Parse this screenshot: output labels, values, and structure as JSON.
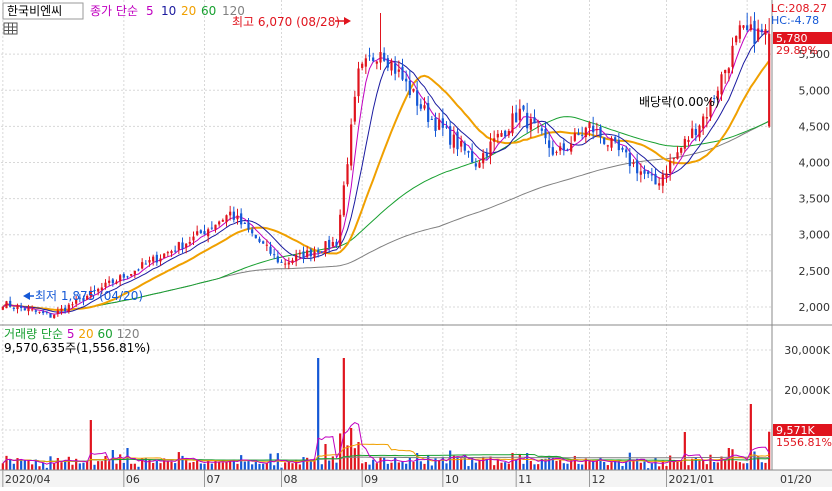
{
  "header": {
    "stock_name": "한국비엔씨",
    "price_label": "종가",
    "ma_label": "단순",
    "ma_periods": [
      "5",
      "10",
      "20",
      "60",
      "120"
    ],
    "lc_text": "LC:208.27",
    "hc_text": "HC:-4.78"
  },
  "volume_header": {
    "title": "거래량",
    "ma_label": "단순",
    "ma_periods": [
      "5",
      "20",
      "60",
      "120"
    ],
    "current_value_text": "9,570,635주(1,556.81%)"
  },
  "annotations": {
    "high_text": "최고 6,070 (08/28)",
    "low_text": "최저 1,875 (04/20)",
    "dividend_text": "배당락(0.00%)"
  },
  "price_badge": {
    "value": "5,780",
    "pct": "29.89%"
  },
  "volume_badge": {
    "value": "9,571K",
    "pct": "1556.81%"
  },
  "colors": {
    "up": "#e0141e",
    "down": "#1458d6",
    "ma5": "#c000c0",
    "ma10": "#1a1aa0",
    "ma20": "#f0a000",
    "ma60": "#18a030",
    "ma120": "#808080",
    "grid": "#d8d8d8"
  },
  "chart_data": [
    {
      "type": "candlestick",
      "title": "한국비엔씨 종가",
      "y_ticks": [
        2000,
        2500,
        3000,
        3500,
        4000,
        4500,
        5000,
        5500
      ],
      "y_tick_labels": [
        "2,000",
        "2,500",
        "3,000",
        "3,500",
        "4,000",
        "4,500",
        "5,000",
        "5,500"
      ],
      "ylim": [
        1750,
        6250
      ],
      "x_tick_labels": [
        "2020/04",
        "06",
        "07",
        "08",
        "09",
        "10",
        "11",
        "12",
        "2021/01",
        "01/20"
      ],
      "x_tick_index": [
        0,
        33,
        55,
        76,
        98,
        120,
        140,
        160,
        181,
        203
      ],
      "high": {
        "date": "08/28",
        "value": 6070
      },
      "low": {
        "date": "04/20",
        "value": 1875
      },
      "last_close": 5780,
      "last_change_pct": 29.89,
      "key_closes": [
        {
          "date": "2020/04/20",
          "value": 1875
        },
        {
          "date": "2020/06/15",
          "value": 2950
        },
        {
          "date": "2020/06/29",
          "value": 3300
        },
        {
          "date": "2020/07/20",
          "value": 2600
        },
        {
          "date": "2020/08/11",
          "value": 2900
        },
        {
          "date": "2020/08/20",
          "value": 5200
        },
        {
          "date": "2020/08/28",
          "value": 5600
        },
        {
          "date": "2020/09/15",
          "value": 4700
        },
        {
          "date": "2020/10/05",
          "value": 4000
        },
        {
          "date": "2020/10/22",
          "value": 4700
        },
        {
          "date": "2020/11/06",
          "value": 4100
        },
        {
          "date": "2020/11/20",
          "value": 4500
        },
        {
          "date": "2020/12/15",
          "value": 3700
        },
        {
          "date": "2021/01/05",
          "value": 4700
        },
        {
          "date": "2021/01/18",
          "value": 5780
        }
      ]
    },
    {
      "type": "bar",
      "title": "거래량",
      "y_ticks": [
        10000,
        20000,
        30000
      ],
      "y_tick_labels": [
        "10,000K",
        "20,000K",
        "30,000K"
      ],
      "ylim": [
        0,
        36000
      ],
      "unit": "K",
      "last_volume": 9570635,
      "last_volume_pct": 1556.81
    }
  ]
}
